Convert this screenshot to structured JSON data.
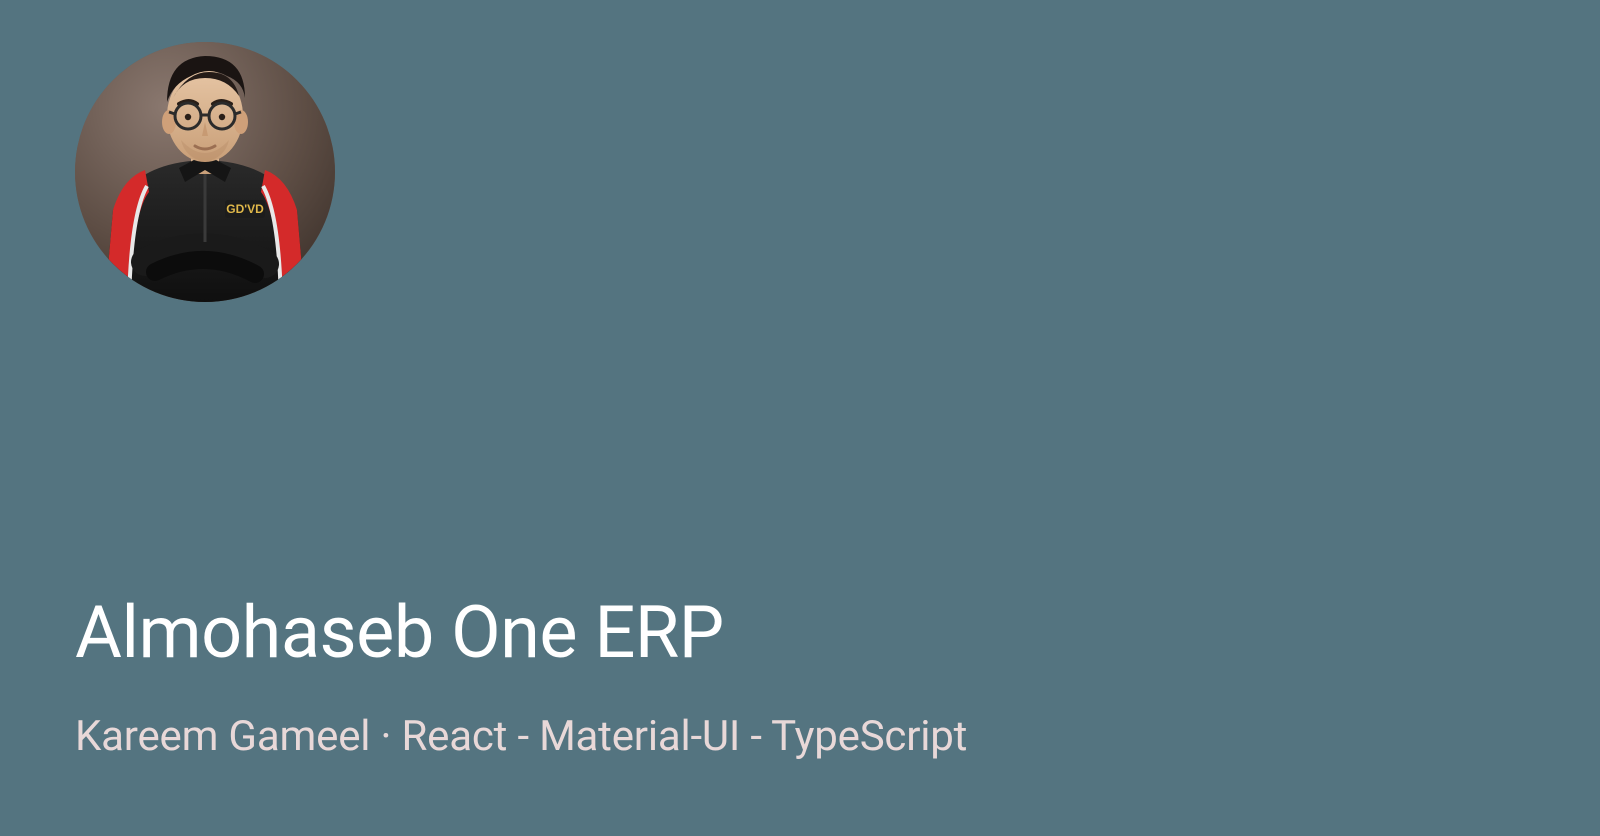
{
  "card": {
    "title": "Almohaseb One ERP",
    "author": "Kareem Gameel",
    "separator": " · ",
    "tech": "React - Material-UI - TypeScript"
  }
}
